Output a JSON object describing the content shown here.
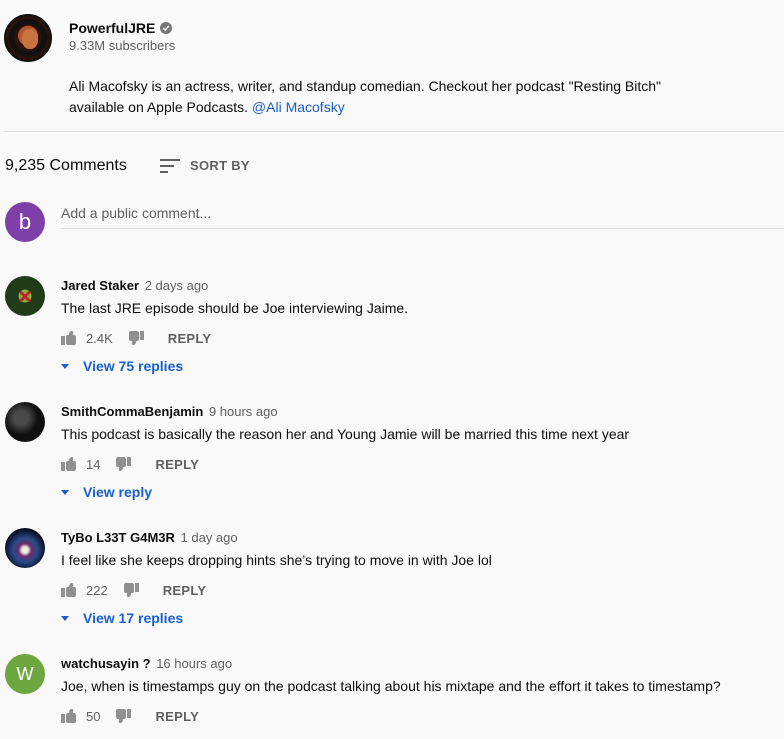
{
  "channel": {
    "name": "PowerfulJRE",
    "subscribers": "9.33M subscribers",
    "description_text": "Ali Macofsky is an actress, writer, and standup comedian. Checkout her podcast \"Resting Bitch\" available on Apple Podcasts. ",
    "description_link": "@Ali Macofsky"
  },
  "comments_header": {
    "count": "9,235 Comments",
    "sort_label": "SORT BY"
  },
  "add_comment": {
    "user_initial": "b",
    "placeholder": "Add a public comment..."
  },
  "comments": [
    {
      "author": "Jared Staker",
      "time": "2 days ago",
      "text": "The last JRE episode should be Joe interviewing Jaime.",
      "likes": "2.4K",
      "reply_label": "REPLY",
      "view_replies": "View 75 replies"
    },
    {
      "author": "SmithCommaBenjamin",
      "time": "9 hours ago",
      "text": "This podcast is basically the reason her and Young Jamie will be married this time next year",
      "likes": "14",
      "reply_label": "REPLY",
      "view_replies": "View reply"
    },
    {
      "author": "TyBo L33T G4M3R",
      "time": "1 day ago",
      "text": "I feel like she keeps dropping hints she’s trying to move in with Joe lol",
      "likes": "222",
      "reply_label": "REPLY",
      "view_replies": "View 17 replies"
    },
    {
      "author": "watchusayin ?",
      "time": "16 hours ago",
      "text": "Joe, when is timestamps guy on the podcast talking about his mixtape and the effort it takes to timestamp?",
      "likes": "50",
      "reply_label": "REPLY",
      "avatar_initial": "W"
    }
  ],
  "colors": {
    "link": "#1a5fd0",
    "user_avatar": "#7e3fa9",
    "letter_avatar": "#6ea63f",
    "background": "#f9f9f9"
  }
}
